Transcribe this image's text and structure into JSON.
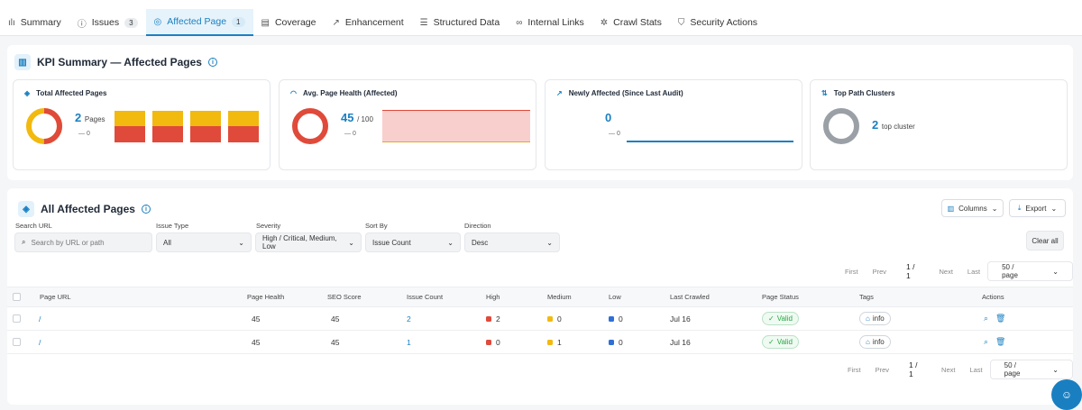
{
  "tabs": [
    {
      "icon": "bar-chart-icon",
      "glyph": "ılı",
      "label": "Summary",
      "badge": ""
    },
    {
      "icon": "alert-circle-icon",
      "glyph": "ⓘ",
      "label": "Issues",
      "badge": "3"
    },
    {
      "icon": "target-icon",
      "glyph": "◎",
      "label": "Affected Page",
      "badge": "1"
    },
    {
      "icon": "document-icon",
      "glyph": "▤",
      "label": "Coverage",
      "badge": ""
    },
    {
      "icon": "trend-up-icon",
      "glyph": "↗",
      "label": "Enhancement",
      "badge": ""
    },
    {
      "icon": "database-icon",
      "glyph": "☰",
      "label": "Structured Data",
      "badge": ""
    },
    {
      "icon": "link-icon",
      "glyph": "∞",
      "label": "Internal Links",
      "badge": ""
    },
    {
      "icon": "spider-icon",
      "glyph": "✲",
      "label": "Crawl Stats",
      "badge": ""
    },
    {
      "icon": "shield-icon",
      "glyph": "⛉",
      "label": "Security Actions",
      "badge": ""
    }
  ],
  "kpi": {
    "title": "KPI Summary — Affected Pages",
    "cards": [
      {
        "title": "Total Affected Pages",
        "value": "2",
        "unit": "Pages",
        "delta": "— 0"
      },
      {
        "title": "Avg. Page Health (Affected)",
        "value": "45",
        "unit": "/ 100",
        "delta": "— 0"
      },
      {
        "title": "Newly Affected (Since Last Audit)",
        "value": "0",
        "unit": "",
        "delta": "— 0"
      },
      {
        "title": "Top Path Clusters",
        "value": "2",
        "unit": "top cluster",
        "delta": ""
      }
    ]
  },
  "table": {
    "title": "All Affected Pages",
    "columns_label": "Columns",
    "export_label": "Export",
    "clear_label": "Clear all",
    "filters": {
      "search_label": "Search URL",
      "search_placeholder": "Search by URL or path",
      "issue_type_label": "Issue Type",
      "issue_type_value": "All",
      "severity_label": "Severity",
      "severity_value": "High / Critical, Medium, Low",
      "sortby_label": "Sort By",
      "sortby_value": "Issue Count",
      "direction_label": "Direction",
      "direction_value": "Desc"
    },
    "pager": {
      "first": "First",
      "prev": "Prev",
      "current": "1 / 1",
      "next": "Next",
      "last": "Last",
      "page_size": "50 / page"
    },
    "headers": {
      "url": "Page URL",
      "health": "Page Health",
      "seo": "SEO Score",
      "issues": "Issue Count",
      "high": "High",
      "medium": "Medium",
      "low": "Low",
      "crawled": "Last Crawled",
      "status": "Page Status",
      "tags": "Tags",
      "actions": "Actions"
    },
    "rows": [
      {
        "url": "/",
        "health": "45",
        "seo": "45",
        "issues": "2",
        "high": "2",
        "medium": "0",
        "low": "0",
        "crawled": "Jul 16",
        "status": "Valid",
        "tag": "info"
      },
      {
        "url": "/",
        "health": "45",
        "seo": "45",
        "issues": "1",
        "high": "0",
        "medium": "1",
        "low": "0",
        "crawled": "Jul 16",
        "status": "Valid",
        "tag": "info"
      }
    ]
  },
  "colors": {
    "accent": "#1a7fc1",
    "high": "#e04a3a",
    "medium": "#f2b90f",
    "low": "#2f6fd6",
    "valid": "#28a745"
  }
}
